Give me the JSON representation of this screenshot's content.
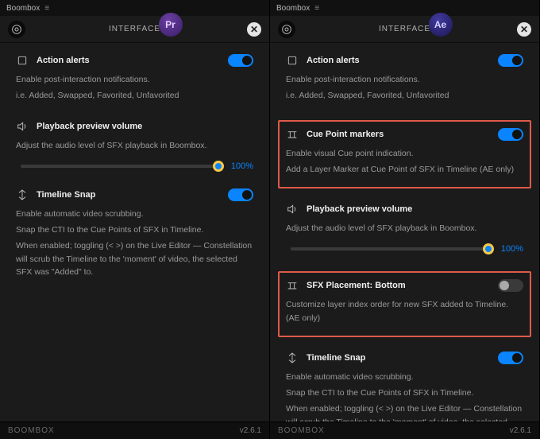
{
  "window": {
    "title": "Boombox"
  },
  "header": {
    "title": "INTERFACE"
  },
  "badges": {
    "pr": "Pr",
    "ae": "Ae"
  },
  "sections": {
    "action_alerts": {
      "title": "Action alerts",
      "desc1": "Enable post-interaction notifications.",
      "desc2": "i.e. Added, Swapped, Favorited, Unfavorited"
    },
    "playback": {
      "title": "Playback preview volume",
      "desc1": "Adjust the audio level of SFX playback in Boombox.",
      "value": "100%"
    },
    "timeline_snap": {
      "title": "Timeline Snap",
      "desc1": "Enable automatic video scrubbing.",
      "desc2": "Snap the CTI to the Cue Points of SFX in Timeline.",
      "desc3": "When enabled; toggling (< >) on the Live Editor — Constellation will scrub the Timeline to the 'moment' of video, the selected SFX was \"Added\" to."
    },
    "cue_point": {
      "title": "Cue Point markers",
      "desc1": "Enable visual Cue point indication.",
      "desc2": "Add a Layer Marker at Cue Point of SFX in Timeline (AE only)"
    },
    "sfx_placement": {
      "title": "SFX Placement: Bottom",
      "desc1": "Customize layer index order for new SFX added to Timeline. (AE only)"
    }
  },
  "footer": {
    "brand": "BOOMBOX",
    "version": "v2.6.1"
  }
}
